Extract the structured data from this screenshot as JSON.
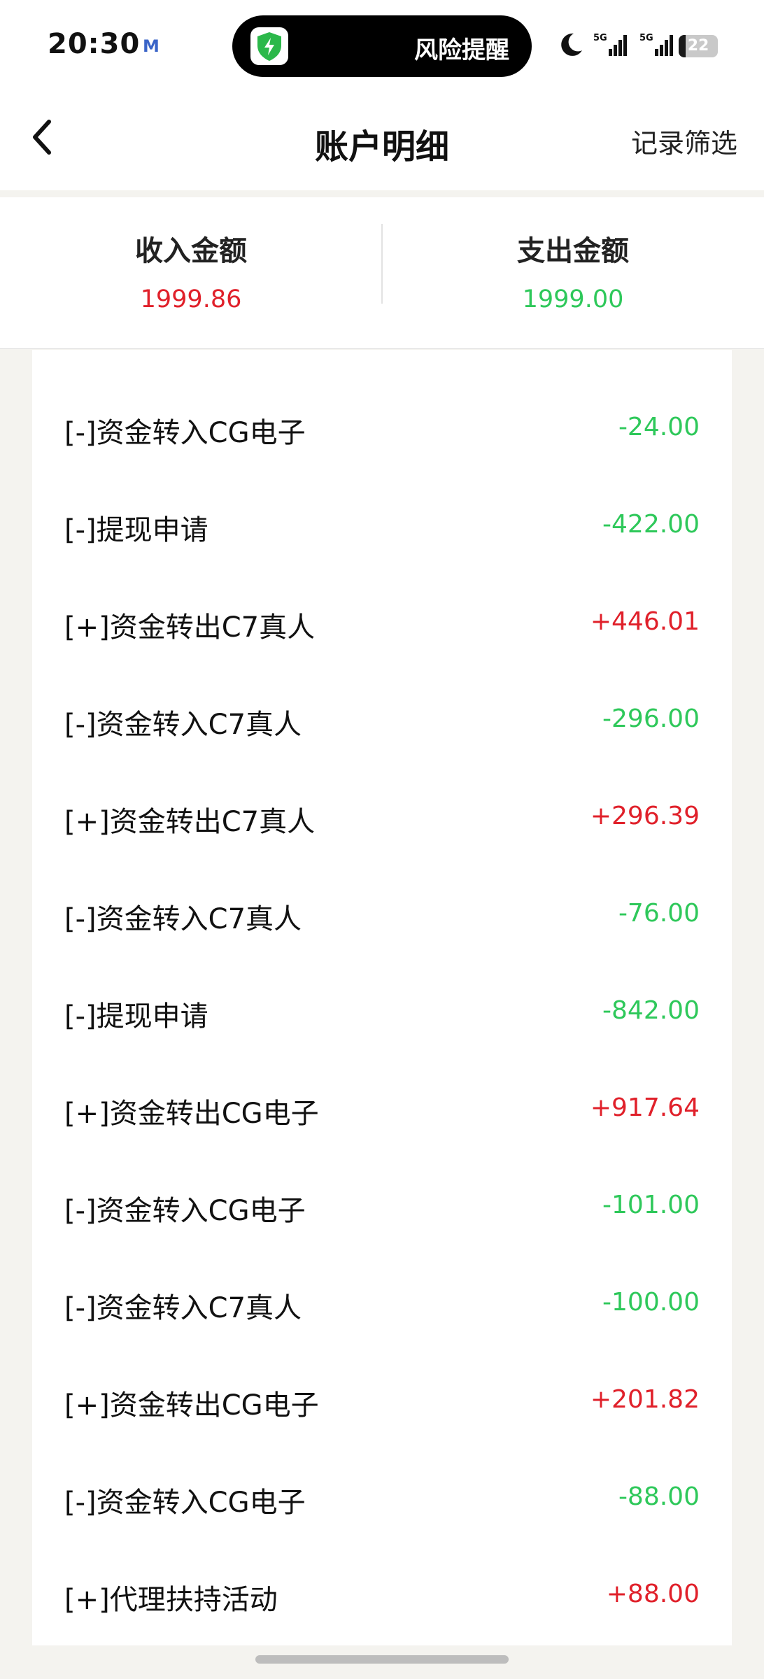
{
  "status_bar": {
    "time": "20:30",
    "mail_icon": "M",
    "island_text": "风险提醒",
    "battery": "22",
    "icons": [
      "shield-bolt-icon",
      "moon-icon",
      "signal-5g-icon",
      "battery-icon"
    ]
  },
  "nav": {
    "title": "账户明细",
    "filter_label": "记录筛选",
    "back_icon": "chevron-left-icon"
  },
  "summary": {
    "income_label": "收入金额",
    "income_value": "1999.86",
    "expense_label": "支出金额",
    "expense_value": "1999.00"
  },
  "colors": {
    "positive": "#e0202a",
    "negative": "#2ec85a",
    "background": "#f4f3ef"
  },
  "records": [
    {
      "desc": "[-]资金转入CG电子",
      "amount": "-24.00"
    },
    {
      "desc": "[-]提现申请",
      "amount": "-422.00"
    },
    {
      "desc": "[+]资金转出C7真人",
      "amount": "+446.01"
    },
    {
      "desc": "[-]资金转入C7真人",
      "amount": "-296.00"
    },
    {
      "desc": "[+]资金转出C7真人",
      "amount": "+296.39"
    },
    {
      "desc": "[-]资金转入C7真人",
      "amount": "-76.00"
    },
    {
      "desc": "[-]提现申请",
      "amount": "-842.00"
    },
    {
      "desc": "[+]资金转出CG电子",
      "amount": "+917.64"
    },
    {
      "desc": "[-]资金转入CG电子",
      "amount": "-101.00"
    },
    {
      "desc": "[-]资金转入C7真人",
      "amount": "-100.00"
    },
    {
      "desc": "[+]资金转出CG电子",
      "amount": "+201.82"
    },
    {
      "desc": "[-]资金转入CG电子",
      "amount": "-88.00"
    },
    {
      "desc": "[+]代理扶持活动",
      "amount": "+88.00"
    }
  ]
}
